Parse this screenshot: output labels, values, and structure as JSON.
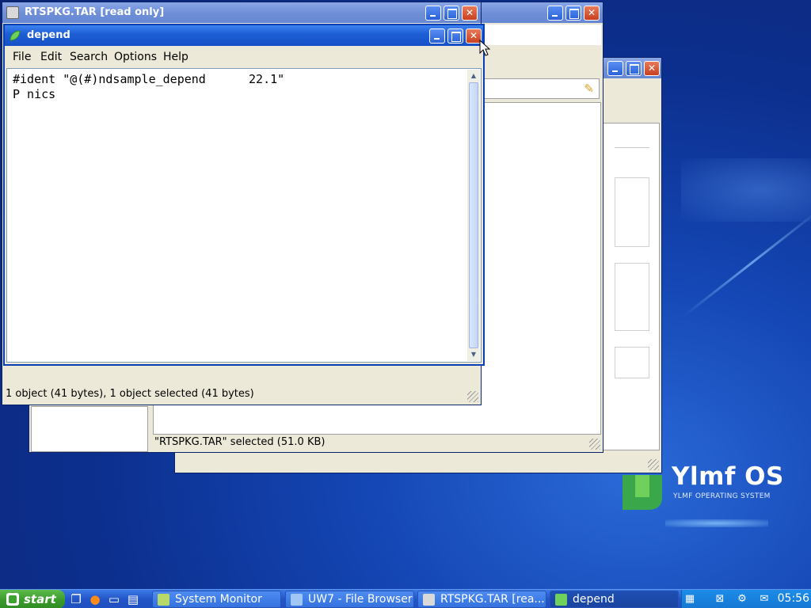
{
  "brand": {
    "name": "Ylmf OS",
    "tagline": "YLMF OPERATING SYSTEM"
  },
  "windows": {
    "back": {
      "title": "",
      "status": ""
    },
    "file_browser": {
      "title": "",
      "status": "\"RTSPKG.TAR\" selected (51.0 KB)"
    },
    "archive": {
      "title": "RTSPKG.TAR [read only]",
      "status": "1 object (41 bytes), 1 object selected (41 bytes)"
    },
    "editor": {
      "title": "depend",
      "menu": [
        "File",
        "Edit",
        "Search",
        "Options",
        "Help"
      ],
      "content_lines": [
        "#ident \"@(#)ndsample_depend      22.1\"",
        "P nics"
      ]
    }
  },
  "taskbar": {
    "start_label": "start",
    "tasks": [
      {
        "label": "System Monitor",
        "active": false
      },
      {
        "label": "UW7 - File Browser",
        "active": false
      },
      {
        "label": "RTSPKG.TAR [rea...",
        "active": false
      },
      {
        "label": "depend",
        "active": true
      }
    ],
    "clock": "05:56"
  },
  "colors": {
    "titlebar": "#1e5fd6",
    "close": "#c8401f",
    "start": "#3a9a2c",
    "tray": "#1577d3"
  }
}
